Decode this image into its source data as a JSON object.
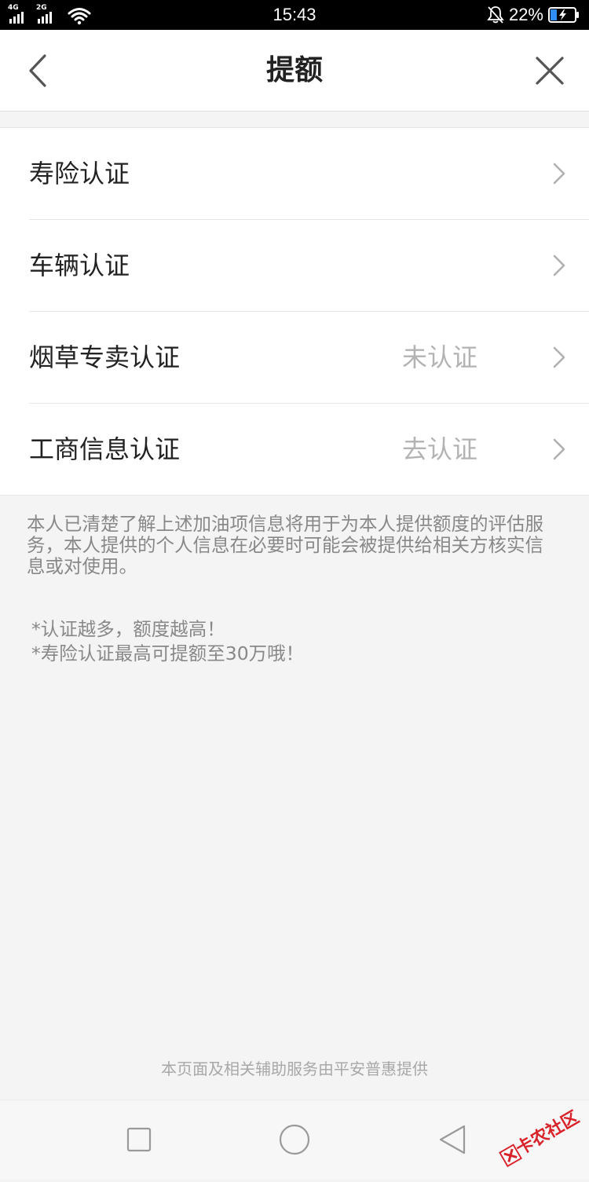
{
  "status_bar": {
    "network_primary": "4G",
    "network_secondary": "2G",
    "time": "15:43",
    "battery_percent": "22%"
  },
  "header": {
    "title": "提额"
  },
  "auth_items": [
    {
      "label": "寿险认证",
      "status": ""
    },
    {
      "label": "车辆认证",
      "status": ""
    },
    {
      "label": "烟草专卖认证",
      "status": "未认证"
    },
    {
      "label": "工商信息认证",
      "status": "去认证"
    }
  ],
  "disclaimer": "本人已清楚了解上述加油项信息将用于为本人提供额度的评估服务，本人提供的个人信息在必要时可能会被提供给相关方核实信息或对使用。",
  "tips": [
    "*认证越多，额度越高！",
    "*寿险认证最高可提额至30万哦！"
  ],
  "provider_note": "本页面及相关辅助服务由平安普惠提供",
  "watermark": {
    "text": "卡农社区"
  },
  "colors": {
    "status_bar_bg": "#000000",
    "page_bg": "#f4f4f4",
    "card_bg": "#ffffff",
    "status_text": "#b3b3b3",
    "note_text": "#888888",
    "battery_fill": "#2f8df5",
    "watermark": "#d9232a"
  }
}
